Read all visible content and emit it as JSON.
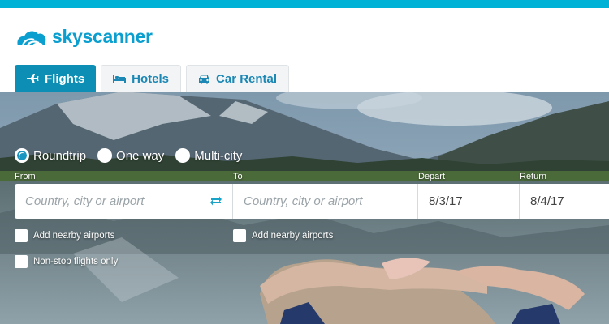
{
  "brand": {
    "logo_text": "skyscanner",
    "colors": {
      "stripe": "#00b2d6",
      "logo": "#0b9fd0",
      "active_tab": "#0d8fb5",
      "tab_text": "#1a87b4"
    }
  },
  "tabs": [
    {
      "label": "Flights",
      "icon": "plane-icon",
      "active": true
    },
    {
      "label": "Hotels",
      "icon": "bed-icon",
      "active": false
    },
    {
      "label": "Car Rental",
      "icon": "car-icon",
      "active": false
    }
  ],
  "trip_types": [
    {
      "label": "Roundtrip",
      "selected": true
    },
    {
      "label": "One way",
      "selected": false
    },
    {
      "label": "Multi-city",
      "selected": false
    }
  ],
  "form": {
    "from": {
      "label": "From",
      "placeholder": "Country, city or airport",
      "value": ""
    },
    "to": {
      "label": "To",
      "placeholder": "Country, city or airport",
      "value": ""
    },
    "depart": {
      "label": "Depart",
      "value": "8/3/17"
    },
    "return": {
      "label": "Return",
      "value": "8/4/17"
    },
    "swap_icon": "swap-arrows-icon"
  },
  "options": {
    "nearby_from": {
      "label": "Add nearby airports",
      "checked": false
    },
    "nearby_to": {
      "label": "Add nearby airports",
      "checked": false
    },
    "nonstop": {
      "label": "Non-stop flights only",
      "checked": false
    }
  }
}
